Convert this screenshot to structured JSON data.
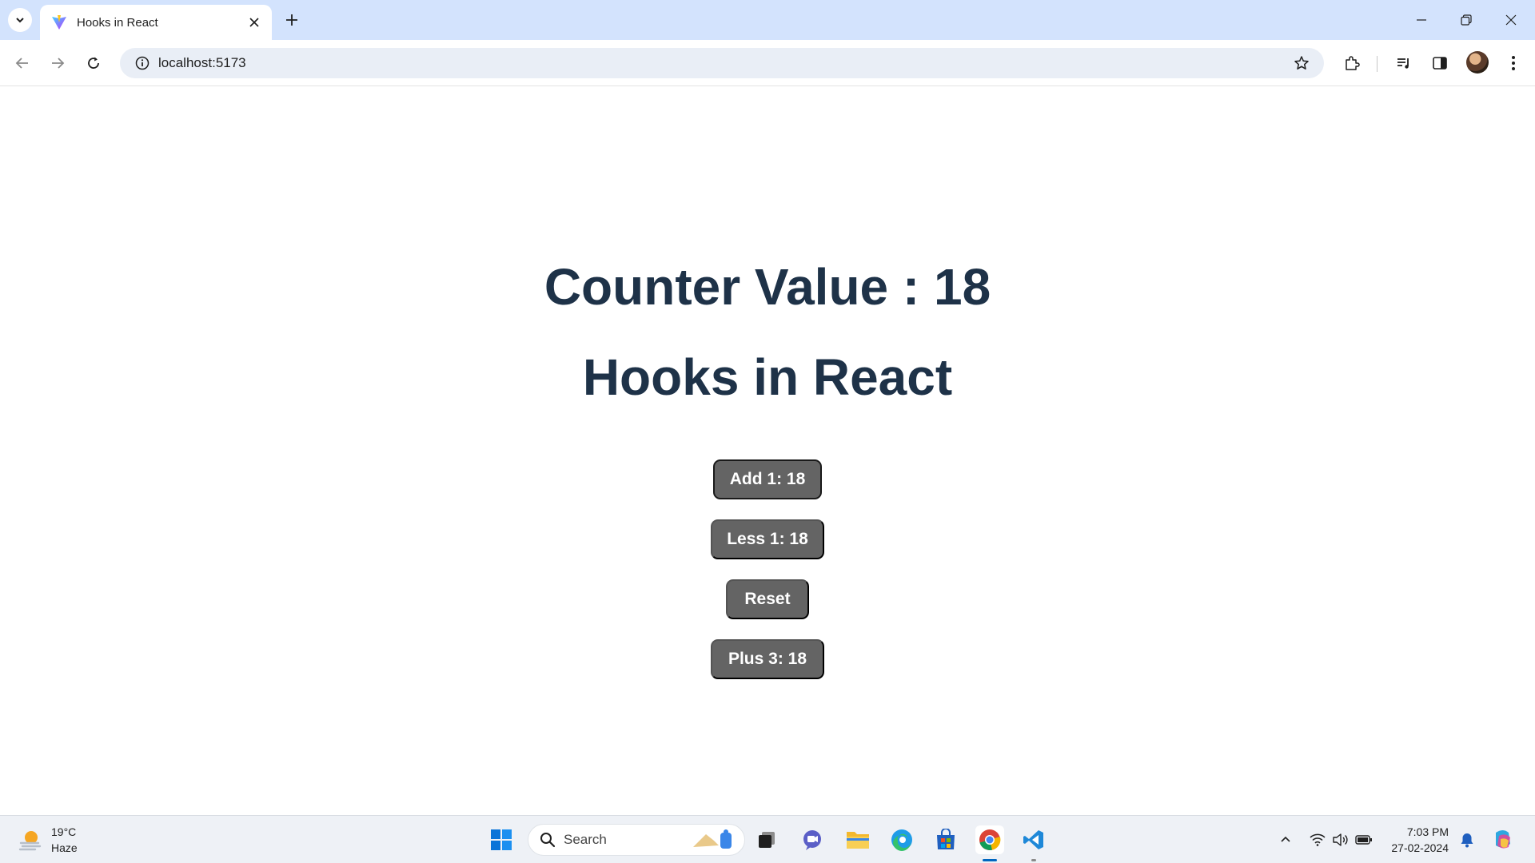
{
  "browser": {
    "tab": {
      "title": "Hooks in React"
    },
    "address": {
      "url": "localhost:5173"
    }
  },
  "page": {
    "counter_heading": "Counter Value : 18",
    "title_heading": "Hooks in React",
    "buttons": {
      "add": "Add 1: 18",
      "less": "Less 1: 18",
      "reset": "Reset",
      "plus": "Plus 3: 18"
    }
  },
  "taskbar": {
    "weather": {
      "temp": "19°C",
      "condition": "Haze"
    },
    "search_label": "Search",
    "clock": {
      "time": "7:03 PM",
      "date": "27-02-2024"
    }
  },
  "colors": {
    "heading": "#1e3248",
    "button_bg": "#646464",
    "tabstrip_bg": "#d3e3fd",
    "omnibox_bg": "#e9eef6"
  }
}
